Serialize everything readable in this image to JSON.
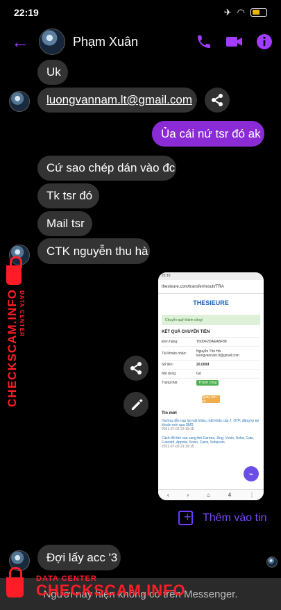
{
  "status": {
    "time": "22:19",
    "battery": "5"
  },
  "conversation": {
    "contact_name": "Phạm Xuân"
  },
  "colors": {
    "accent": "#a23cff",
    "sent_bubble": "#8b2bd6",
    "incoming_bubble": "#333333",
    "watermark": "#ff1c26"
  },
  "messages": {
    "uk": "Uk",
    "email": "luongvannam.lt@gmail.com",
    "sent": "Ủa cái nứ tsr đó ak",
    "copy": "Cứ sao chép dán vào đc",
    "account": "Tk tsr đó",
    "mail": "Mail tsr",
    "ctk": "CTK nguyễn thu hà",
    "waiting": "Đợi lấy acc '3"
  },
  "screenshot": {
    "time": "22:16",
    "url": "thesieure.com/transfer/result/TRA",
    "brand": "THESIEURE",
    "notice": "Chuyển quỹ thành công!",
    "title": "KẾT QUẢ CHUYỂN TIỀN",
    "rows": [
      {
        "label": "Đơn hàng:",
        "value": "T60DF2DAEABF88"
      },
      {
        "label": "Tài khoản nhận:",
        "value": "Nguyễn Thu Hà"
      },
      {
        "label": "Số tiền:",
        "value": "20,000đ"
      },
      {
        "label": "Nội dung:",
        "value": "Gd"
      },
      {
        "label": "Trạng thái:",
        "value": "Thành công"
      }
    ],
    "email": "luongvannam.lt@gmail.com",
    "button": "Quay lịch sử",
    "news_heading": "Tin mới",
    "news_1": "Hướng dẫn nạp lại mật khẩu, mật khẩu cấp 2, OTP, đăng ký tài khoản mới qua SMS",
    "news_1_time": "2021-07-02 22:19:15",
    "news_2": "Cách đổi thẻ cào sang thẻ Garena, Zing, Vcoin, Soha, Gate, Funcard, Appota, Scoin, Carot, Sohacoin",
    "news_2_time": "2021-07-02 21:19:15",
    "tab_count": "4"
  },
  "story": {
    "label": "Thêm vào tin"
  },
  "footer": {
    "text": "Người này hiện không có trên Messenger."
  },
  "watermark": {
    "small": "DATA CENTER",
    "large": "CHECKSCAM.INFO"
  },
  "icons": {
    "back": "back-arrow-icon",
    "phone": "phone-icon",
    "video": "video-camera-icon",
    "info": "info-icon",
    "share": "share-icon",
    "edit": "pencil-icon",
    "story": "add-to-story-icon"
  }
}
